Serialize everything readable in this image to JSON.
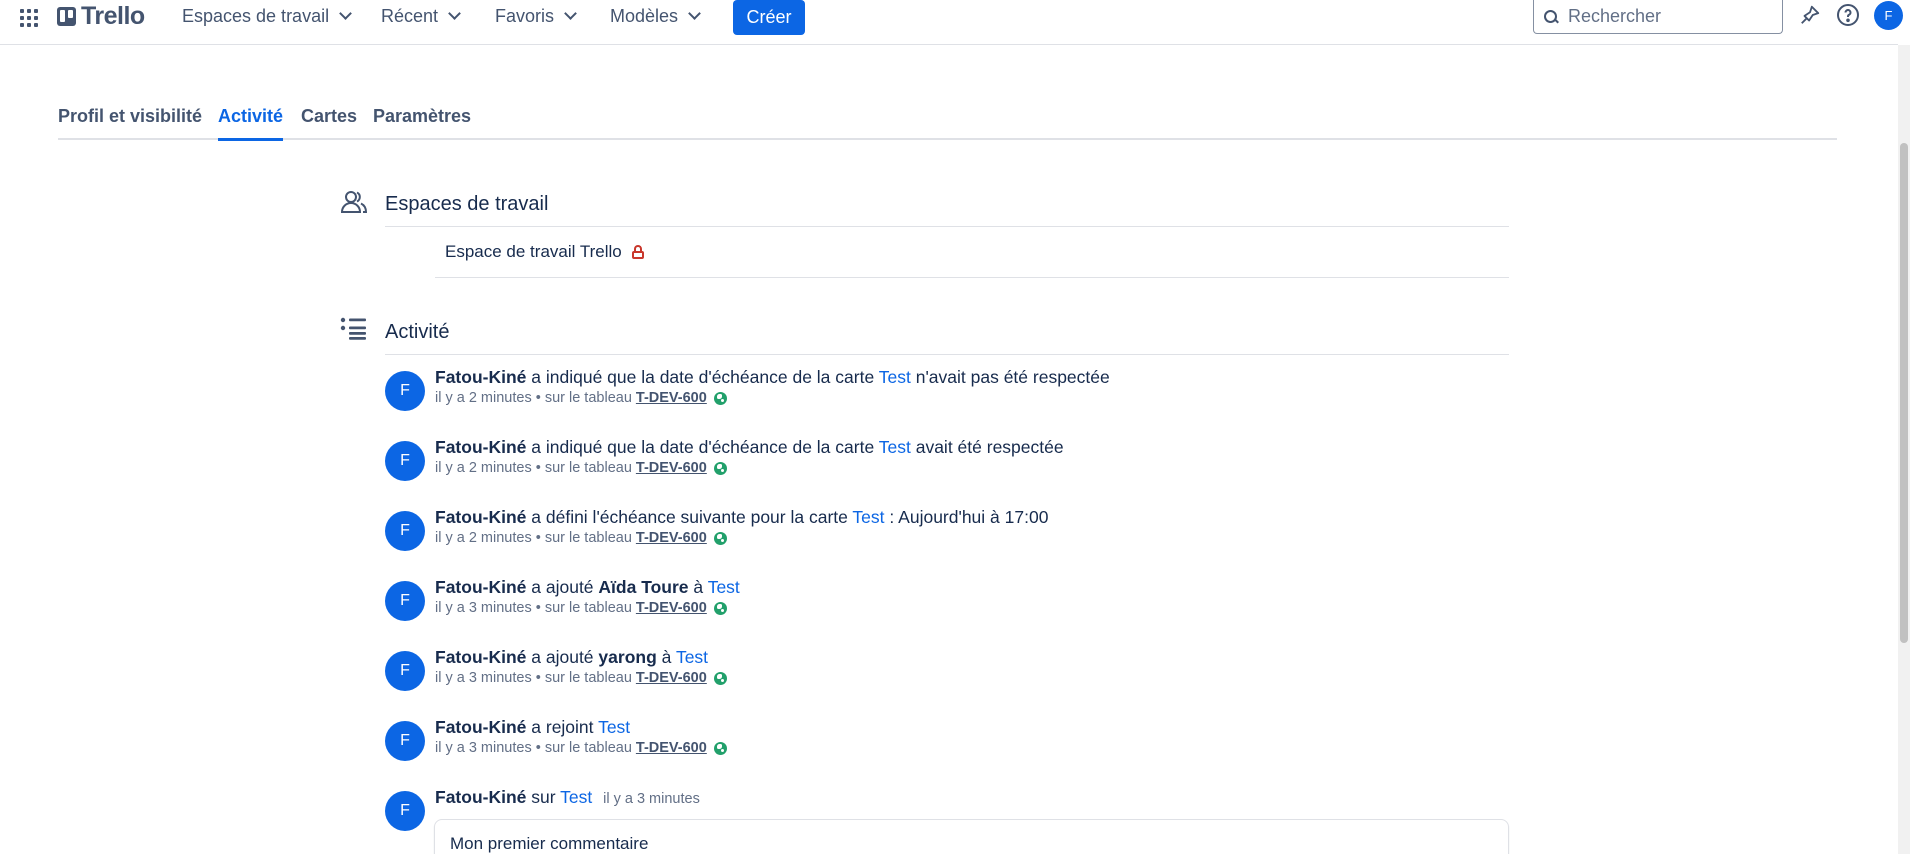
{
  "header": {
    "logo": "Trello",
    "nav": [
      "Espaces de travail",
      "Récent",
      "Favoris",
      "Modèles"
    ],
    "create_label": "Créer",
    "search_placeholder": "Rechercher",
    "avatar_initial": "F"
  },
  "tabs": [
    "Profil et visibilité",
    "Activité",
    "Cartes",
    "Paramètres"
  ],
  "active_tab": "Activité",
  "workspaces": {
    "title": "Espaces de travail",
    "items": [
      "Espace de travail Trello"
    ]
  },
  "activity": {
    "title": "Activité",
    "items": [
      {
        "avatar": "F",
        "user": "Fatou-Kiné",
        "text_before": "a indiqué que la date d'échéance de la carte",
        "bold_target": "",
        "connector": "",
        "card": "Test",
        "text_after": "n'avait pas été respectée",
        "time": "il y a 2 minutes",
        "board_prefix": "• sur le tableau",
        "board": "T-DEV-600"
      },
      {
        "avatar": "F",
        "user": "Fatou-Kiné",
        "text_before": "a indiqué que la date d'échéance de la carte",
        "bold_target": "",
        "connector": "",
        "card": "Test",
        "text_after": "avait été respectée",
        "time": "il y a 2 minutes",
        "board_prefix": "• sur le tableau",
        "board": "T-DEV-600"
      },
      {
        "avatar": "F",
        "user": "Fatou-Kiné",
        "text_before": "a défini l'échéance suivante pour la carte",
        "bold_target": "",
        "connector": "",
        "card": "Test",
        "text_after": ": Aujourd'hui à 17:00",
        "time": "il y a 2 minutes",
        "board_prefix": "• sur le tableau",
        "board": "T-DEV-600"
      },
      {
        "avatar": "F",
        "user": "Fatou-Kiné",
        "text_before": "a ajouté",
        "bold_target": "Aïda Toure",
        "connector": "à",
        "card": "Test",
        "text_after": "",
        "time": "il y a 3 minutes",
        "board_prefix": "• sur le tableau",
        "board": "T-DEV-600"
      },
      {
        "avatar": "F",
        "user": "Fatou-Kiné",
        "text_before": "a ajouté",
        "bold_target": "yarong",
        "connector": "à",
        "card": "Test",
        "text_after": "",
        "time": "il y a 3 minutes",
        "board_prefix": "• sur le tableau",
        "board": "T-DEV-600"
      },
      {
        "avatar": "F",
        "user": "Fatou-Kiné",
        "text_before": "a rejoint",
        "bold_target": "",
        "connector": "",
        "card": "Test",
        "text_after": "",
        "time": "il y a 3 minutes",
        "board_prefix": "• sur le tableau",
        "board": "T-DEV-600"
      }
    ],
    "comment": {
      "avatar": "F",
      "user": "Fatou-Kiné",
      "on": "sur",
      "card": "Test",
      "time": "il y a 3 minutes",
      "body": "Mon premier commentaire"
    }
  }
}
